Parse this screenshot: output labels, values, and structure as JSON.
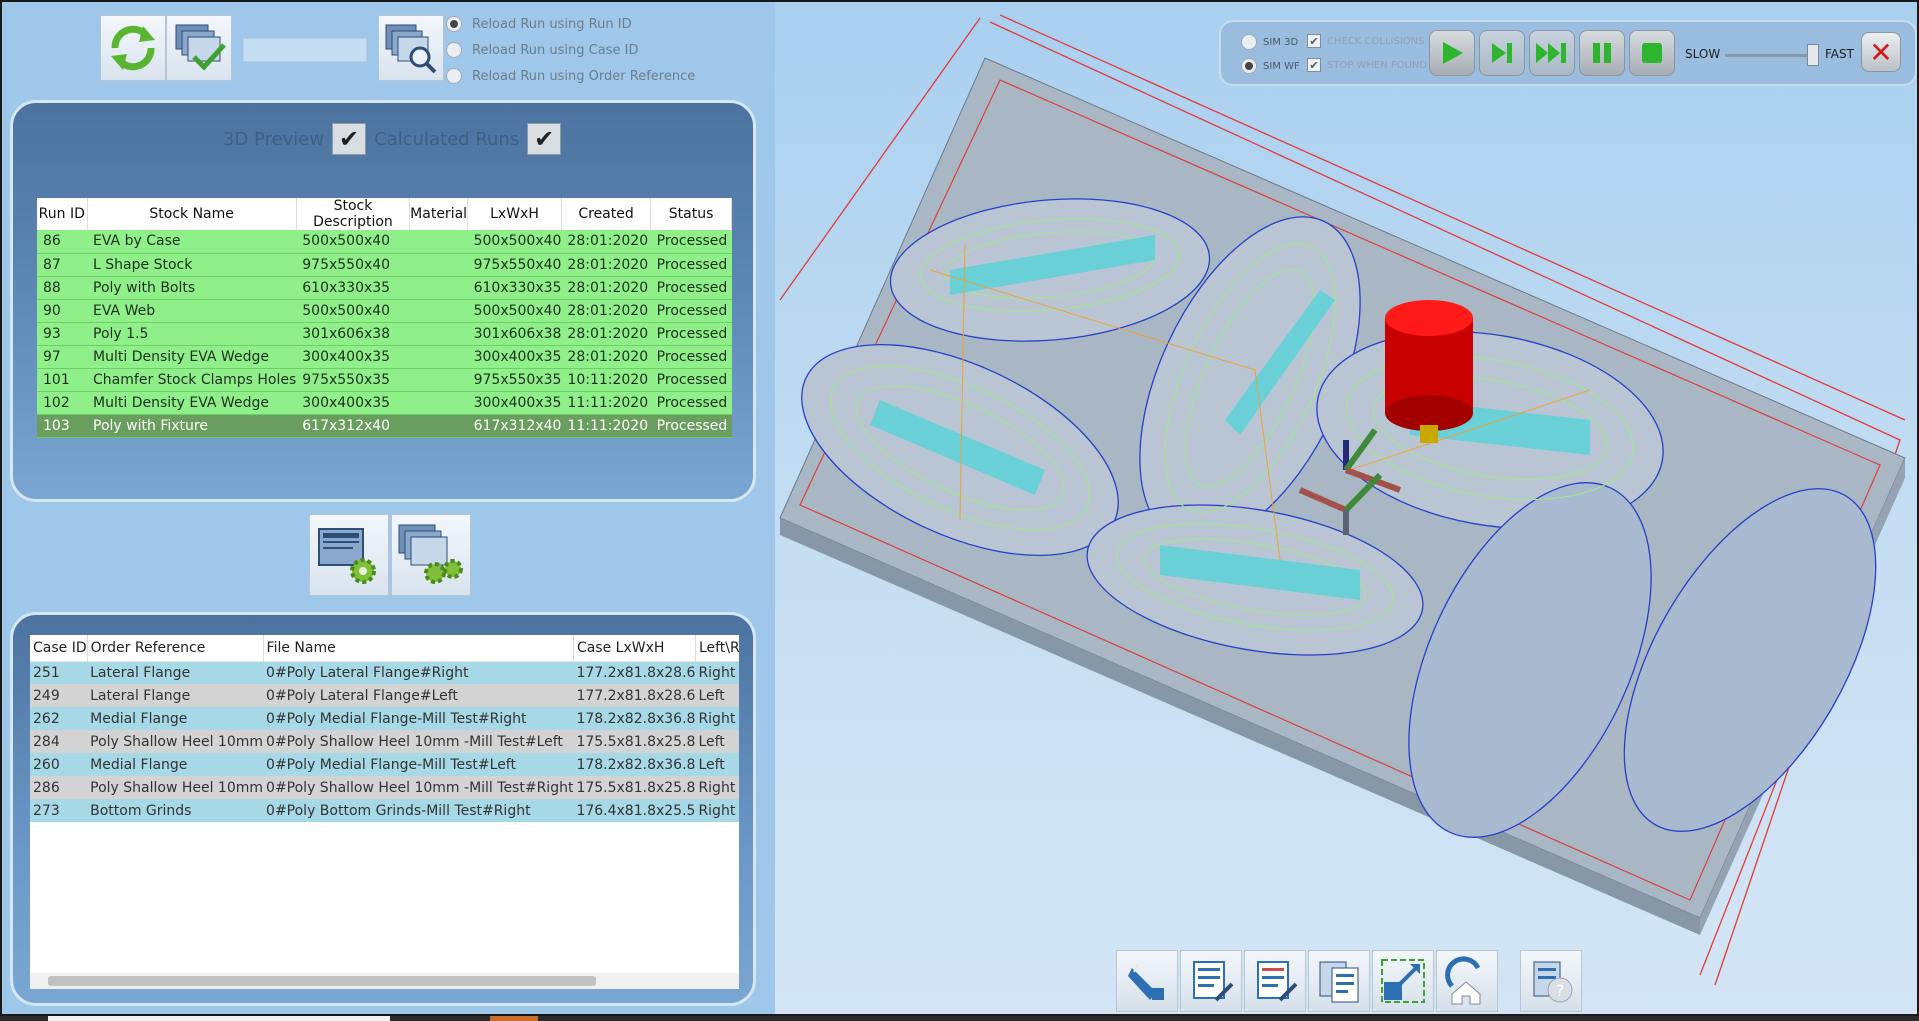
{
  "toolbar": {
    "run_id_value": "",
    "reload_options": [
      {
        "label": "Reload Run using Run ID",
        "selected": true
      },
      {
        "label": "Reload Run using Case ID",
        "selected": false
      },
      {
        "label": "Reload Run using Order Reference",
        "selected": false
      }
    ]
  },
  "runs_panel": {
    "preview_label": "3D Preview",
    "preview_checked": true,
    "calculated_label": "Calculated Runs",
    "calculated_checked": true,
    "columns": [
      "Run ID",
      "Stock Name",
      "Stock Description",
      "Material",
      "LxWxH",
      "Created",
      "Status"
    ],
    "rows": [
      {
        "run_id": "86",
        "stock_name": "EVA by Case",
        "stock_description": "500x500x40",
        "material": "",
        "lxwxh": "500x500x40",
        "created": "28:01:2020",
        "status": "Processed"
      },
      {
        "run_id": "87",
        "stock_name": "L Shape Stock",
        "stock_description": "975x550x40",
        "material": "",
        "lxwxh": "975x550x40",
        "created": "28:01:2020",
        "status": "Processed"
      },
      {
        "run_id": "88",
        "stock_name": "Poly with Bolts",
        "stock_description": "610x330x35",
        "material": "",
        "lxwxh": "610x330x35",
        "created": "28:01:2020",
        "status": "Processed"
      },
      {
        "run_id": "90",
        "stock_name": "EVA Web",
        "stock_description": "500x500x40",
        "material": "",
        "lxwxh": "500x500x40",
        "created": "28:01:2020",
        "status": "Processed"
      },
      {
        "run_id": "93",
        "stock_name": "Poly 1.5",
        "stock_description": "301x606x38",
        "material": "",
        "lxwxh": "301x606x38",
        "created": "28:01:2020",
        "status": "Processed"
      },
      {
        "run_id": "97",
        "stock_name": "Multi Density EVA Wedge",
        "stock_description": "300x400x35",
        "material": "",
        "lxwxh": "300x400x35",
        "created": "28:01:2020",
        "status": "Processed"
      },
      {
        "run_id": "101",
        "stock_name": "Chamfer Stock Clamps Holes",
        "stock_description": "975x550x35",
        "material": "",
        "lxwxh": "975x550x35",
        "created": "10:11:2020",
        "status": "Processed"
      },
      {
        "run_id": "102",
        "stock_name": "Multi Density EVA Wedge",
        "stock_description": "300x400x35",
        "material": "",
        "lxwxh": "300x400x35",
        "created": "11:11:2020",
        "status": "Processed"
      },
      {
        "run_id": "103",
        "stock_name": "Poly with Fixture",
        "stock_description": "617x312x40",
        "material": "",
        "lxwxh": "617x312x40",
        "created": "11:11:2020",
        "status": "Processed",
        "selected": true
      }
    ]
  },
  "cases_panel": {
    "columns": [
      "Case ID",
      "Order Reference",
      "File Name",
      "Case LxWxH",
      "Left\\R"
    ],
    "rows": [
      {
        "case_id": "251",
        "order_reference": "Lateral Flange",
        "file_name": "0#Poly Lateral Flange#Right",
        "case_lxwxh": "177.2x81.8x28.6",
        "side": "Right"
      },
      {
        "case_id": "249",
        "order_reference": "Lateral Flange",
        "file_name": "0#Poly Lateral Flange#Left",
        "case_lxwxh": "177.2x81.8x28.6",
        "side": "Left"
      },
      {
        "case_id": "262",
        "order_reference": "Medial Flange",
        "file_name": "0#Poly Medial Flange-Mill Test#Right",
        "case_lxwxh": "178.2x82.8x36.8",
        "side": "Right"
      },
      {
        "case_id": "284",
        "order_reference": "Poly Shallow Heel 10mm",
        "file_name": "0#Poly Shallow Heel 10mm -Mill Test#Left",
        "case_lxwxh": "175.5x81.8x25.8",
        "side": "Left"
      },
      {
        "case_id": "260",
        "order_reference": "Medial Flange",
        "file_name": "0#Poly Medial Flange-Mill Test#Left",
        "case_lxwxh": "178.2x82.8x36.8",
        "side": "Left"
      },
      {
        "case_id": "286",
        "order_reference": "Poly Shallow Heel 10mm",
        "file_name": "0#Poly Shallow Heel 10mm -Mill Test#Right",
        "case_lxwxh": "175.5x81.8x25.8",
        "side": "Right"
      },
      {
        "case_id": "273",
        "order_reference": "Bottom Grinds",
        "file_name": "0#Poly Bottom Grinds-Mill Test#Right",
        "case_lxwxh": "176.4x81.8x25.5",
        "side": "Right"
      }
    ]
  },
  "sim_bar": {
    "sim3d_label": "SIM 3D",
    "simwf_label": "SIM WF",
    "check_collisions_label": "CHECK COLLISIONS",
    "stop_when_found_label": "STOP WHEN FOUND",
    "slow_label": "SLOW",
    "fast_label": "FAST",
    "speed_level": 0.9
  },
  "colors": {
    "processed_row": "#8ff08a",
    "selected_row": "#6a9e5e",
    "panel_blue": "#5c86b3",
    "toolpath_green": "#9fe88a",
    "stock_grey": "#a6b4c2",
    "cutter_red": "#dd0a0a"
  },
  "icons": [
    "refresh-icon",
    "confirm-run-icon",
    "search-doc-icon",
    "settings-doc-icon",
    "settings-multi-doc-icon",
    "play-icon",
    "step-icon",
    "fast-forward-icon",
    "pause-icon",
    "stop-icon",
    "close-icon",
    "tool-icon",
    "nc-edit-icon",
    "nc-edit-alt-icon",
    "report-icon",
    "fit-view-icon",
    "home-view-icon",
    "help-icon"
  ]
}
